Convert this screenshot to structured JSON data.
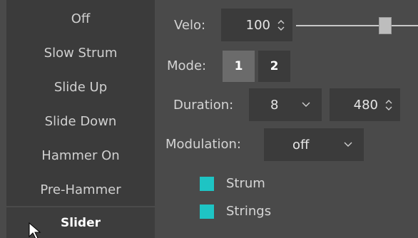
{
  "list": {
    "items": [
      "Off",
      "Slow Strum",
      "Slide Up",
      "Slide Down",
      "Hammer On",
      "Pre-Hammer"
    ],
    "selected": "Slider"
  },
  "velo": {
    "label": "Velo:",
    "value": "100",
    "slider_level": 0.74
  },
  "mode": {
    "label": "Mode:",
    "buttons": [
      "1",
      "2"
    ],
    "active": "1"
  },
  "duration": {
    "label": "Duration:",
    "select_value": "8",
    "spin_value": "480"
  },
  "modulation": {
    "label": "Modulation:",
    "value": "off"
  },
  "checkboxes": [
    {
      "label": "Strum",
      "checked": true
    },
    {
      "label": "Strings",
      "checked": true
    }
  ],
  "colors": {
    "panel_bg": "#4a4a4a",
    "list_bg": "#3b3b3b",
    "checkbox_accent": "#1ec4c4"
  },
  "icons": [
    "spin-up-icon",
    "spin-down-icon",
    "dropdown-arrow-icon",
    "mouse-cursor-icon"
  ]
}
